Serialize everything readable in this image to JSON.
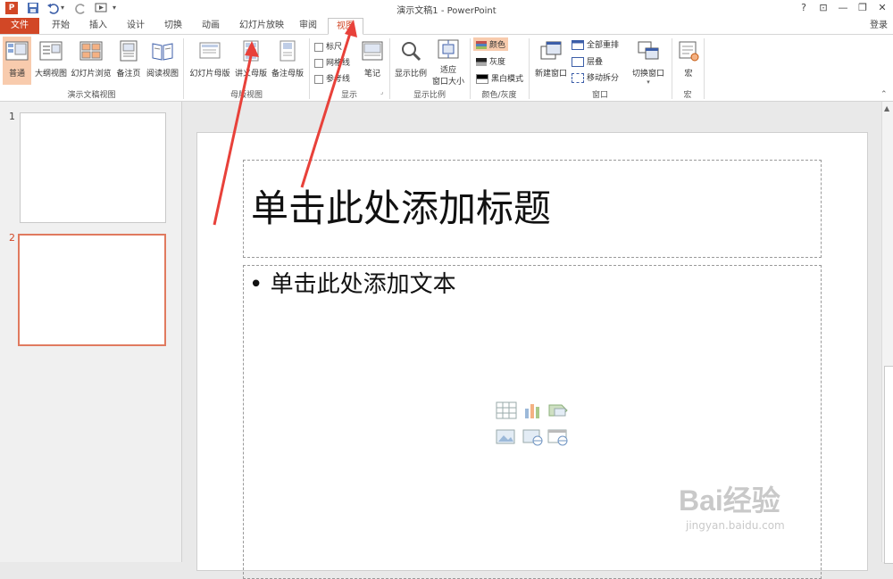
{
  "window": {
    "title": "演示文稿1 - PowerPoint",
    "help": "?",
    "controls": [
      "⊡",
      "—",
      "❐",
      "✕"
    ]
  },
  "tabs": [
    {
      "label": "文件"
    },
    {
      "label": "开始"
    },
    {
      "label": "插入"
    },
    {
      "label": "设计"
    },
    {
      "label": "切换"
    },
    {
      "label": "动画"
    },
    {
      "label": "幻灯片放映"
    },
    {
      "label": "审阅"
    },
    {
      "label": "视图"
    }
  ],
  "login_label": "登录",
  "ribbon": {
    "groups": [
      {
        "label": "演示文稿视图"
      },
      {
        "label": "母版视图"
      },
      {
        "label": "显示"
      },
      {
        "label": "显示比例"
      },
      {
        "label": "颜色/灰度"
      },
      {
        "label": "窗口"
      },
      {
        "label": "宏"
      }
    ],
    "presentation_views": [
      "普通",
      "大纲视图",
      "幻灯片浏览",
      "备注页",
      "阅读视图"
    ],
    "master_views": [
      "幻灯片母版",
      "讲义母版",
      "备注母版"
    ],
    "show": {
      "ruler": "标尺",
      "gridlines": "网格线",
      "guides": "参考线",
      "notes": "笔记"
    },
    "zoom": {
      "zoom": "显示比例",
      "fit": "适应",
      "fit2": "窗口大小"
    },
    "color": {
      "color": "颜色",
      "gray": "灰度",
      "bw": "黑白模式"
    },
    "window": {
      "new": "新建窗口",
      "arrange": "全部重排",
      "cascade": "层叠",
      "move": "移动拆分",
      "switch": "切换窗口"
    },
    "macro": {
      "label": "宏"
    }
  },
  "thumbnails": [
    {
      "number": "1"
    },
    {
      "number": "2"
    }
  ],
  "slide": {
    "title_placeholder": "单击此处添加标题",
    "body_placeholder": "单击此处添加文本",
    "bullet": "•"
  },
  "watermark": {
    "brand": "Bai经验",
    "url": "jingyan.baidu.com"
  },
  "colors": {
    "accent": "#d24726",
    "selected": "#f8cbad",
    "arrow": "#e8413a"
  }
}
